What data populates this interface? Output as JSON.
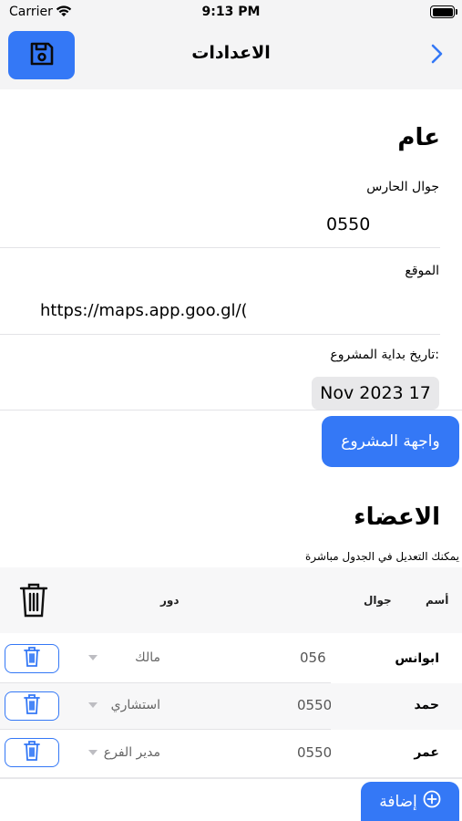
{
  "status_bar": {
    "carrier": "Carrier",
    "time": "9:13 PM"
  },
  "nav": {
    "title": "الاعدادات",
    "save_icon": "save-icon",
    "back_icon": "chevron-right-icon"
  },
  "general": {
    "title": "عام",
    "guard_phone_label": "جوال الحارس",
    "guard_phone_value": "0550",
    "location_label": "الموقع",
    "location_value": "https://maps.app.goo.gl/(",
    "start_date_label": "تاريخ بداية المشروع:",
    "start_date_value": "Nov 2023 17",
    "project_button": "واجهة المشروع"
  },
  "members": {
    "title": "الاعضاء",
    "hint": "يمكنك التعديل في الجدول مباشرة",
    "columns": {
      "name": "أسم",
      "phone": "جوال",
      "role": "دور"
    },
    "rows": [
      {
        "name": "ابوانس",
        "phone": "056",
        "role": "مالك"
      },
      {
        "name": "حمد",
        "phone": "0550",
        "role": "استشاري"
      },
      {
        "name": "عمر",
        "phone": "0550",
        "role": "مدير الفرع"
      }
    ],
    "add_button": "إضافة"
  },
  "colors": {
    "accent": "#3478f6",
    "nav_bg": "#f4f4f5"
  }
}
